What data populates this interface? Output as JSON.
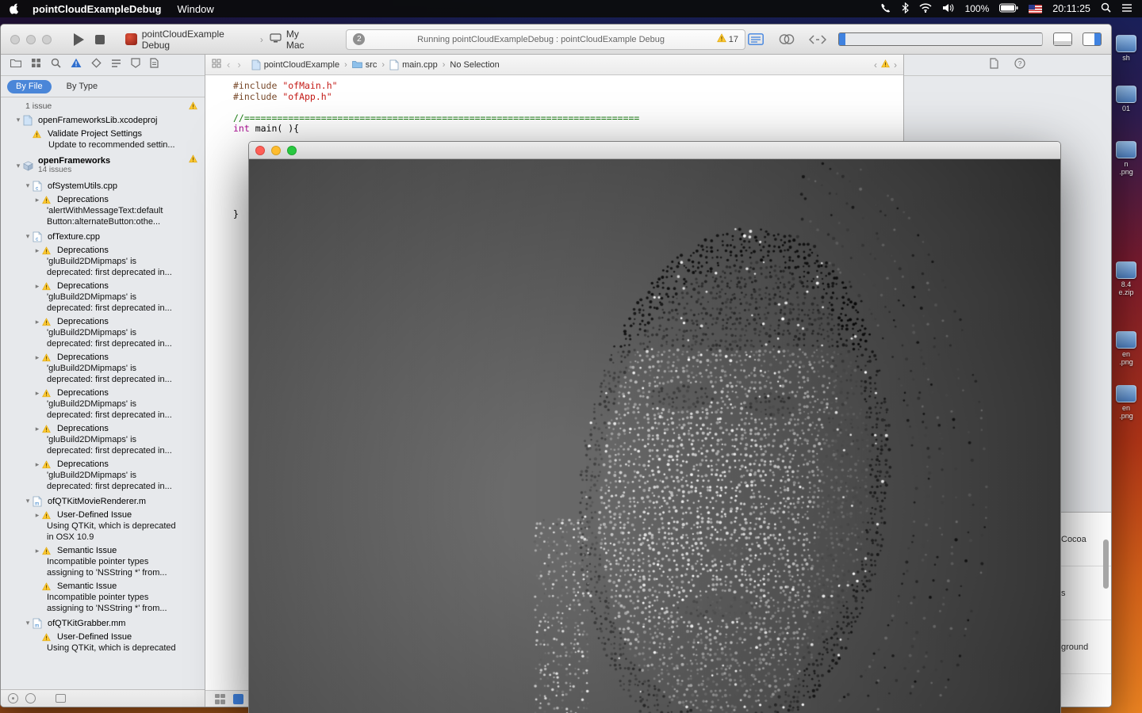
{
  "menubar": {
    "app_name": "pointCloudExampleDebug",
    "menus": [
      "Window"
    ],
    "battery_label": "100%",
    "clock": "20:11:25"
  },
  "toolbar": {
    "scheme": "pointCloudExample Debug",
    "destination": "My Mac",
    "task_badge": "2",
    "status_text": "Running pointCloudExampleDebug : pointCloudExample Debug",
    "warning_count": "17"
  },
  "navigator": {
    "filter_tabs": [
      {
        "label": "By File",
        "selected": true
      },
      {
        "label": "By Type",
        "selected": false
      }
    ],
    "rows": [
      {
        "t": "sub",
        "text": "1 issue",
        "warn": true
      },
      {
        "t": "file",
        "icon": "xcodeproj",
        "text": "openFrameworksLib.xcodeproj",
        "disc": "open",
        "lvl": 1
      },
      {
        "t": "issue",
        "text": "Validate Project Settings",
        "disc": "none",
        "lvl": 2
      },
      {
        "t": "det",
        "lines": [
          "Update to recommended settin..."
        ],
        "lvl": 2
      },
      {
        "t": "proj",
        "text": "openFrameworks",
        "sub": "14 issues",
        "warn": true,
        "disc": "open"
      },
      {
        "t": "file",
        "icon": "cpp",
        "text": "ofSystemUtils.cpp",
        "disc": "open",
        "lvl": 2
      },
      {
        "t": "issue",
        "text": "Deprecations",
        "disc": "closed",
        "lvl": 3
      },
      {
        "t": "det",
        "lines": [
          "'alertWithMessageText:default",
          "Button:alternateButton:othe..."
        ],
        "lvl": 3
      },
      {
        "t": "file",
        "icon": "cpp",
        "text": "ofTexture.cpp",
        "disc": "open",
        "lvl": 2
      },
      {
        "t": "issue",
        "text": "Deprecations",
        "disc": "closed",
        "lvl": 3
      },
      {
        "t": "det",
        "lines": [
          "'gluBuild2DMipmaps' is",
          "deprecated: first deprecated in..."
        ],
        "lvl": 3
      },
      {
        "t": "issue",
        "text": "Deprecations",
        "disc": "closed",
        "lvl": 3
      },
      {
        "t": "det",
        "lines": [
          "'gluBuild2DMipmaps' is",
          "deprecated: first deprecated in..."
        ],
        "lvl": 3
      },
      {
        "t": "issue",
        "text": "Deprecations",
        "disc": "closed",
        "lvl": 3
      },
      {
        "t": "det",
        "lines": [
          "'gluBuild2DMipmaps' is",
          "deprecated: first deprecated in..."
        ],
        "lvl": 3
      },
      {
        "t": "issue",
        "text": "Deprecations",
        "disc": "closed",
        "lvl": 3
      },
      {
        "t": "det",
        "lines": [
          "'gluBuild2DMipmaps' is",
          "deprecated: first deprecated in..."
        ],
        "lvl": 3
      },
      {
        "t": "issue",
        "text": "Deprecations",
        "disc": "closed",
        "lvl": 3
      },
      {
        "t": "det",
        "lines": [
          "'gluBuild2DMipmaps' is",
          "deprecated: first deprecated in..."
        ],
        "lvl": 3
      },
      {
        "t": "issue",
        "text": "Deprecations",
        "disc": "closed",
        "lvl": 3
      },
      {
        "t": "det",
        "lines": [
          "'gluBuild2DMipmaps' is",
          "deprecated: first deprecated in..."
        ],
        "lvl": 3
      },
      {
        "t": "issue",
        "text": "Deprecations",
        "disc": "closed",
        "lvl": 3
      },
      {
        "t": "det",
        "lines": [
          "'gluBuild2DMipmaps' is",
          "deprecated: first deprecated in..."
        ],
        "lvl": 3
      },
      {
        "t": "file",
        "icon": "m",
        "text": "ofQTKitMovieRenderer.m",
        "disc": "open",
        "lvl": 2
      },
      {
        "t": "issue",
        "text": "User-Defined Issue",
        "disc": "closed",
        "lvl": 3
      },
      {
        "t": "det",
        "lines": [
          "Using QTKit, which is deprecated",
          "in OSX 10.9"
        ],
        "lvl": 3
      },
      {
        "t": "issue",
        "text": "Semantic Issue",
        "disc": "closed",
        "lvl": 3
      },
      {
        "t": "det",
        "lines": [
          "Incompatible pointer types",
          "assigning to 'NSString *' from..."
        ],
        "lvl": 3
      },
      {
        "t": "issue",
        "text": "Semantic Issue",
        "disc": "none",
        "lvl": 3
      },
      {
        "t": "det",
        "lines": [
          "Incompatible pointer types",
          "assigning to 'NSString *' from..."
        ],
        "lvl": 3
      },
      {
        "t": "file",
        "icon": "mm",
        "text": "ofQTKitGrabber.mm",
        "disc": "open",
        "lvl": 2
      },
      {
        "t": "issue",
        "text": "User-Defined Issue",
        "disc": "none",
        "lvl": 3
      },
      {
        "t": "det",
        "lines": [
          "Using QTKit, which is deprecated"
        ],
        "lvl": 3
      }
    ]
  },
  "jumpbar": {
    "crumbs": [
      {
        "label": "pointCloudExample",
        "icon": "doc-blue"
      },
      {
        "label": "src",
        "icon": "folder"
      },
      {
        "label": "main.cpp",
        "icon": "doc"
      },
      {
        "label": "No Selection",
        "icon": ""
      }
    ]
  },
  "code": {
    "lines": [
      [
        {
          "s": "#include ",
          "c": "pre"
        },
        {
          "s": "\"ofMain.h\"",
          "c": "str"
        }
      ],
      [
        {
          "s": "#include ",
          "c": "pre"
        },
        {
          "s": "\"ofApp.h\"",
          "c": "str"
        }
      ],
      [],
      [
        {
          "s": "//========================================================================",
          "c": "com"
        }
      ],
      [
        {
          "s": "int",
          "c": "kw"
        },
        {
          "s": " main( ){",
          "c": "pln"
        }
      ],
      [],
      [],
      [],
      [],
      [],
      [],
      [],
      [
        {
          "s": "}",
          "c": "pln"
        }
      ]
    ]
  },
  "library_panel": {
    "items": [
      "Cocoa",
      "s",
      "ground"
    ]
  },
  "desktop": {
    "icons": [
      {
        "label_lines": [
          "sh"
        ]
      },
      {
        "label_lines": [
          "01"
        ]
      },
      {
        "label_lines": [
          "n",
          ".png"
        ]
      },
      {
        "label_lines": [
          "8.4",
          "e.zip"
        ]
      },
      {
        "label_lines": [
          "en",
          ".png"
        ]
      },
      {
        "label_lines": [
          "en",
          ".png"
        ]
      }
    ]
  },
  "colors": {
    "accent_blue": "#4a86d8",
    "warning_yellow": "#fdc830",
    "app_window_bg_center": "#757575",
    "app_window_bg_edge": "#232323"
  }
}
